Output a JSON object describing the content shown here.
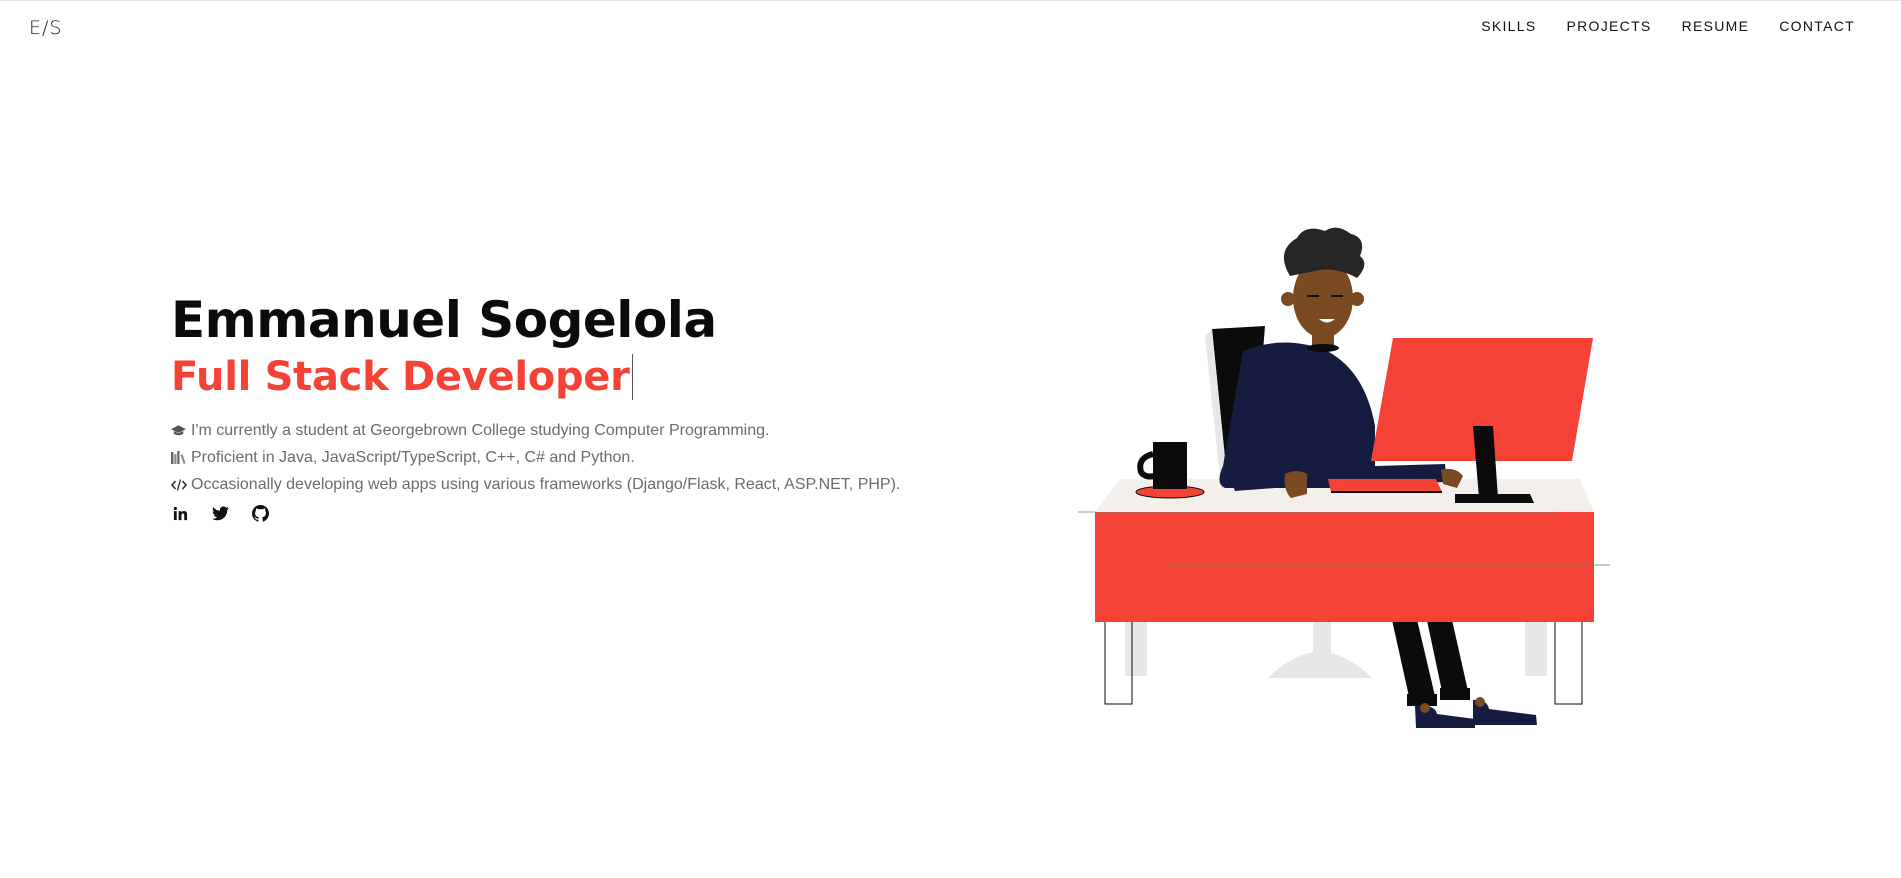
{
  "header": {
    "logo": "E/S",
    "nav": [
      {
        "label": "SKILLS"
      },
      {
        "label": "PROJECTS"
      },
      {
        "label": "RESUME"
      },
      {
        "label": "CONTACT"
      }
    ]
  },
  "hero": {
    "name": "Emmanuel Sogelola",
    "role": "Full Stack Developer",
    "bio": [
      {
        "icon": "graduation-cap-icon",
        "text": "I'm currently a student at Georgebrown College studying Computer Programming."
      },
      {
        "icon": "books-icon",
        "text": "Proficient in Java, JavaScript/TypeScript, C++, C# and Python."
      },
      {
        "icon": "code-icon",
        "text": "Occasionally developing web apps using various frameworks (Django/Flask, React, ASP.NET, PHP)."
      }
    ],
    "social": [
      {
        "icon": "linkedin-icon"
      },
      {
        "icon": "twitter-icon"
      },
      {
        "icon": "github-icon"
      }
    ]
  },
  "colors": {
    "accent": "#f44336",
    "text": "#0b0b0b",
    "muted": "#6b6b6b",
    "navy": "#151c3f"
  }
}
